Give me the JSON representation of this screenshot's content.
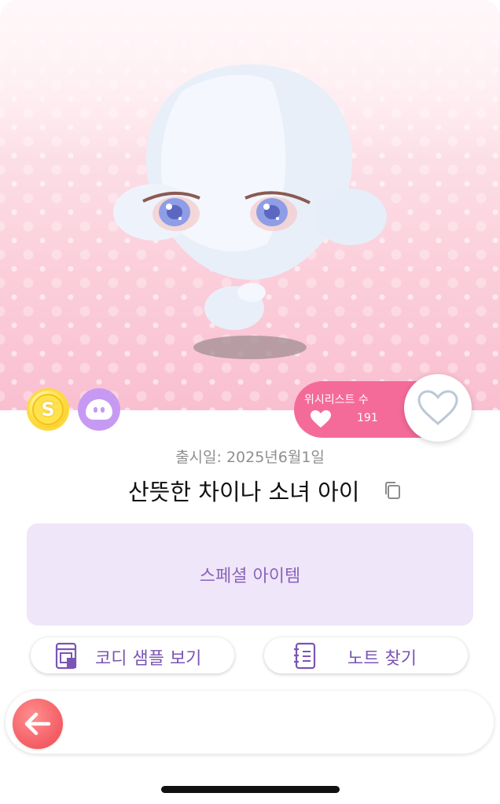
{
  "item": {
    "release_date": "출시일: 2025년6월1일",
    "name": "산뜻한 차이나 소녀 아이",
    "category": "스페셜 아이템"
  },
  "wishlist": {
    "label": "위시리스트 수",
    "count": "191"
  },
  "buttons": {
    "codi_sample": "코디 샘플 보기",
    "find_note": "노트 찾기"
  },
  "badges": {
    "coin_letter": "S",
    "coin_icon": "coin-s-icon",
    "face_icon": "face-icon"
  },
  "colors": {
    "accent_pink": "#f46b9a",
    "purple_text": "#7a55b3",
    "special_bg": "#f0e6fa",
    "back_button": "#f35c63"
  }
}
